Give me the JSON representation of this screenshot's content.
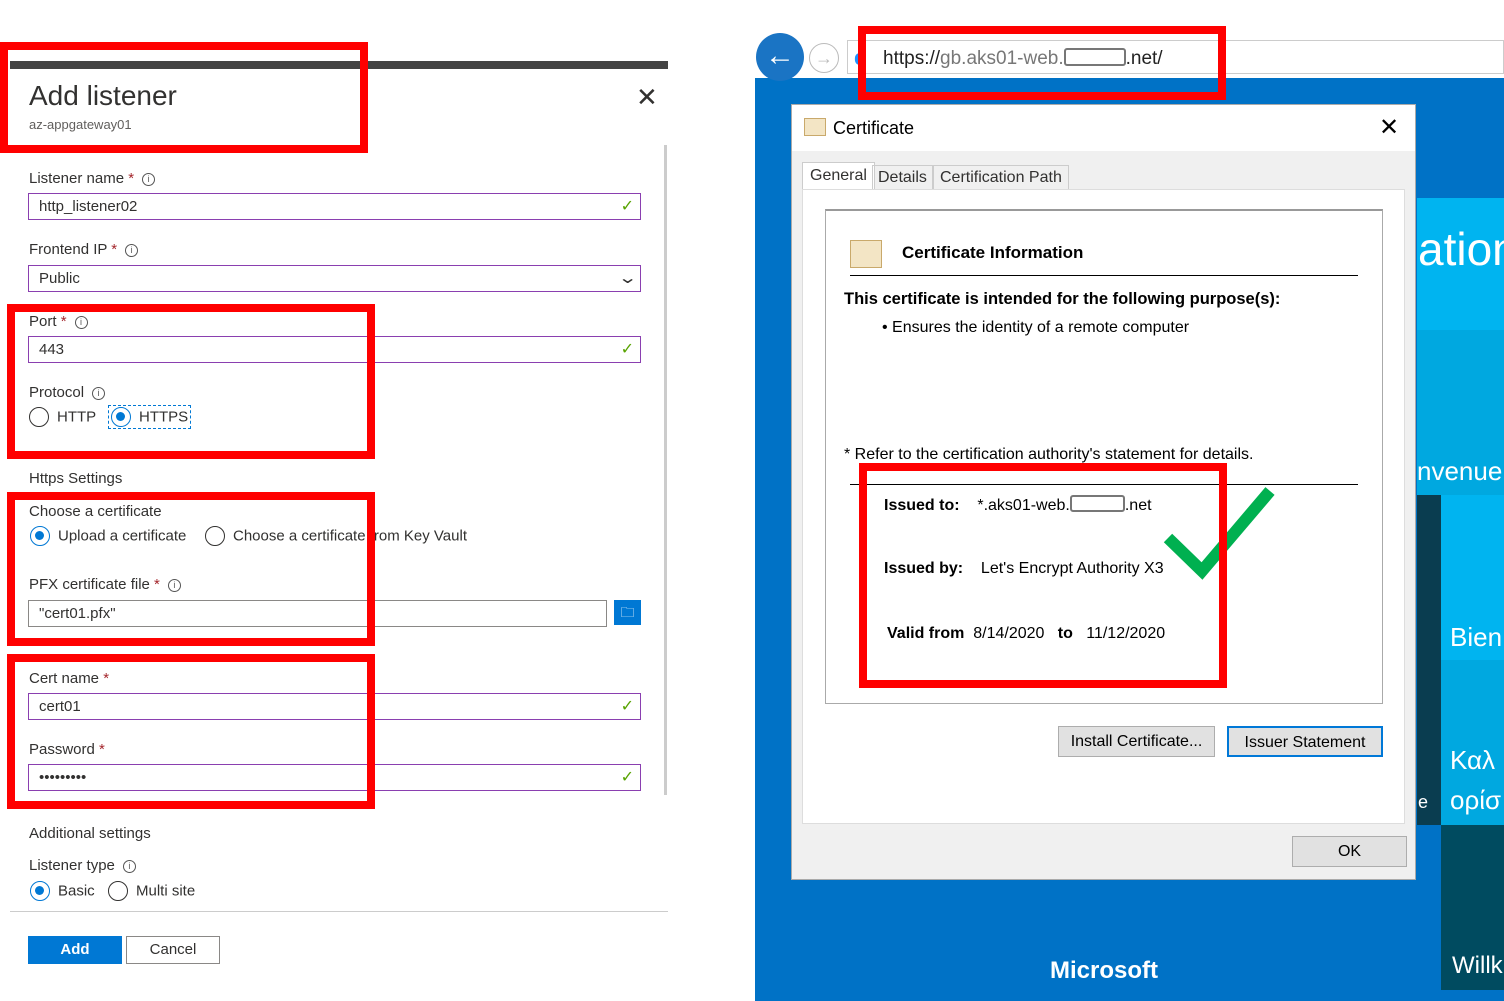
{
  "panel": {
    "title": "Add listener",
    "subtitle": "az-appgateway01",
    "listener_name_label": "Listener name",
    "listener_name_value": "http_listener02",
    "frontend_ip_label": "Frontend IP",
    "frontend_ip_value": "Public",
    "port_label": "Port",
    "port_value": "443",
    "protocol_label": "Protocol",
    "protocol_options": [
      "HTTP",
      "HTTPS"
    ],
    "protocol_selected": "HTTPS",
    "https_settings": "Https Settings",
    "choose_cert_label": "Choose a certificate",
    "cert_options": [
      "Upload a certificate",
      "Choose a certificate from Key Vault"
    ],
    "pfx_label": "PFX certificate file",
    "pfx_value": "\"cert01.pfx\"",
    "cert_name_label": "Cert name",
    "cert_name_value": "cert01",
    "password_label": "Password",
    "password_value": "•••••••••",
    "additional_settings": "Additional settings",
    "listener_type_label": "Listener type",
    "listener_type_options": [
      "Basic",
      "Multi site"
    ],
    "listener_type_selected": "Basic",
    "add": "Add",
    "cancel": "Cancel",
    "required": "*",
    "info": "i"
  },
  "browser": {
    "url_prefix": "https://",
    "url_host": "gb.aks01-web.",
    "url_suffix": ".net/"
  },
  "cert": {
    "title": "Certificate",
    "tabs": [
      "General",
      "Details",
      "Certification Path"
    ],
    "info_heading": "Certificate Information",
    "purpose_heading": "This certificate is intended for the following purpose(s):",
    "purpose": "• Ensures the identity of a remote computer",
    "refer": "* Refer to the certification authority's statement for details.",
    "issued_to_label": "Issued to:",
    "issued_to_prefix": "*.aks01-web.",
    "issued_to_suffix": ".net",
    "issued_by_label": "Issued by:",
    "issued_by": "Let's Encrypt Authority X3",
    "valid_from_label": "Valid from",
    "valid_from": "8/14/2020",
    "to_label": "to",
    "valid_to": "11/12/2020",
    "install": "Install Certificate...",
    "issuer_statement": "Issuer Statement",
    "ok": "OK"
  },
  "background": {
    "tiles": [
      "ation",
      "nvenue",
      "Bien",
      "Καλ",
      "ορίσ",
      "e",
      "Willk"
    ],
    "brand": "Microsoft"
  },
  "colors": {
    "azure_blue": "#0078d4",
    "highlight_red": "#ff0000",
    "check_green": "#00b050"
  }
}
